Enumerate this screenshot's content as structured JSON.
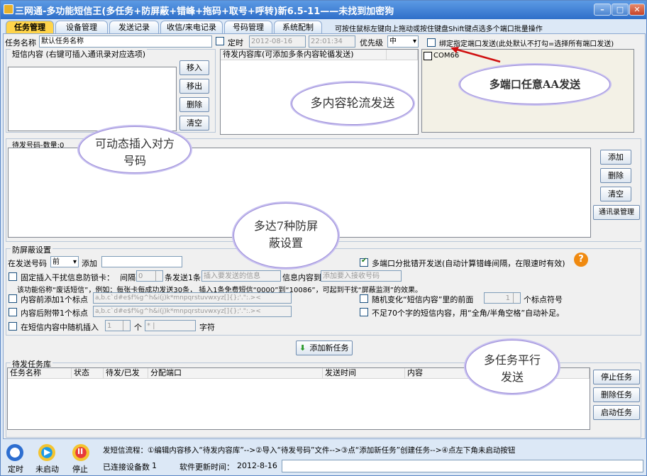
{
  "window": {
    "title": "三网通-多功能短信王(多任务+防屏蔽+错峰+拖码+取号+呼转)新6.5-11——未找到加密狗",
    "controls": [
      "–",
      "□",
      "✕"
    ]
  },
  "tabs": [
    "任务管理",
    "设备管理",
    "发送记录",
    "收信/来电记录",
    "号码管理",
    "系统配制"
  ],
  "tab_hint": "可按住鼠标左键向上拖动或按住键盘Shift键点选多个端口批量操作",
  "task": {
    "name_label": "任务名称",
    "name_value": "默认任务名称",
    "timed_label": "定时",
    "date_value": "2012-08-16",
    "time_value": "22:01:34",
    "priority_label": "优先级",
    "priority_value": "中",
    "bind_port_label": "绑定指定端口发送(此处默认不打勾=选择所有端口发送)"
  },
  "sms": {
    "group_label": "短信内容 (右键可插入通讯录对应选项)",
    "queue_header": "待发内容库(可添加多条内容轮循发送)",
    "buttons": [
      "移入",
      "移出",
      "删除",
      "清空"
    ]
  },
  "ports": {
    "items": [
      {
        "label": "COM66",
        "checked": false
      }
    ]
  },
  "numbers": {
    "group_label": "待发号码-数量:0",
    "buttons": [
      "添加",
      "删除",
      "清空",
      "通讯录管理"
    ]
  },
  "antiblock": {
    "group_label": "防屏蔽设置",
    "insert_label": "在发送号码",
    "position_value": "前",
    "add_label": "添加",
    "fixed_label": "固定插入干扰信息防锁卡：",
    "interval_label": "间隔",
    "interval_value": "0",
    "send_one_label": "条发送1条",
    "send_one_placeholder": "插入要发送的信息",
    "content_to_label": "信息内容到",
    "receiver_placeholder": "添加要入接收号码",
    "explain": "该功能俗称“废话短信”，例如：每张卡每成功发送30条，   插入1条免费短信“0000”到“10086”，可起到干扰“屏蔽监测”的效果。",
    "prefix_label": "内容前添加1个标点",
    "suffix_label": "内容后附带1个标点",
    "punct_value": "a,b.c`d#e$f%g^h&i(j)k*mnpqrstuvwxyz[]{};'.\":.><",
    "random_insert_label": "在短信内容中随机插入",
    "random_count": "1",
    "unit_label": "个",
    "random_char": "*  |",
    "char_label": "字符",
    "multi_port_label": "多端口分批错开发送(自动计算错峰间隔，在限速时有效)",
    "random_change_label": "随机变化“短信内容”里的前面",
    "random_change_count": "1",
    "punct_count_label": "个标点符号",
    "pad_label": "不足70个字的短信内容，用“全角/半角空格”自动补足。"
  },
  "add_task_button": "添加新任务",
  "task_list": {
    "group_label": "待发任务库",
    "columns": [
      "任务名称",
      "状态",
      "待发/已发",
      "分配端口",
      "发送时间",
      "内容"
    ],
    "buttons": [
      "停止任务",
      "删除任务",
      "启动任务"
    ]
  },
  "bottom": {
    "timer_label": "定时",
    "start_label": "未启动",
    "stop_label": "停止",
    "flow_text": "发短信流程：①编辑内容移入“待发内容库”-->②导入“待发号码”文件-->③点“添加新任务”创建任务-->④点左下角未启动按钮",
    "connected_label": "已连接设备数",
    "connected_count": "1",
    "update_label": "软件更新时间：",
    "update_date": "2012-8-16"
  },
  "callouts": {
    "multi_content": "多内容轮流发送",
    "multi_port": "多端口任意AA发送",
    "insert_number": "可动态插入对方号码",
    "antiblock7": "多达7种防屏蔽设置",
    "multi_task": "多任务平行发送"
  },
  "colors": {
    "accent": "#2f6fc9",
    "active_tab": "#ffd44a",
    "arrow": "#d01010"
  }
}
